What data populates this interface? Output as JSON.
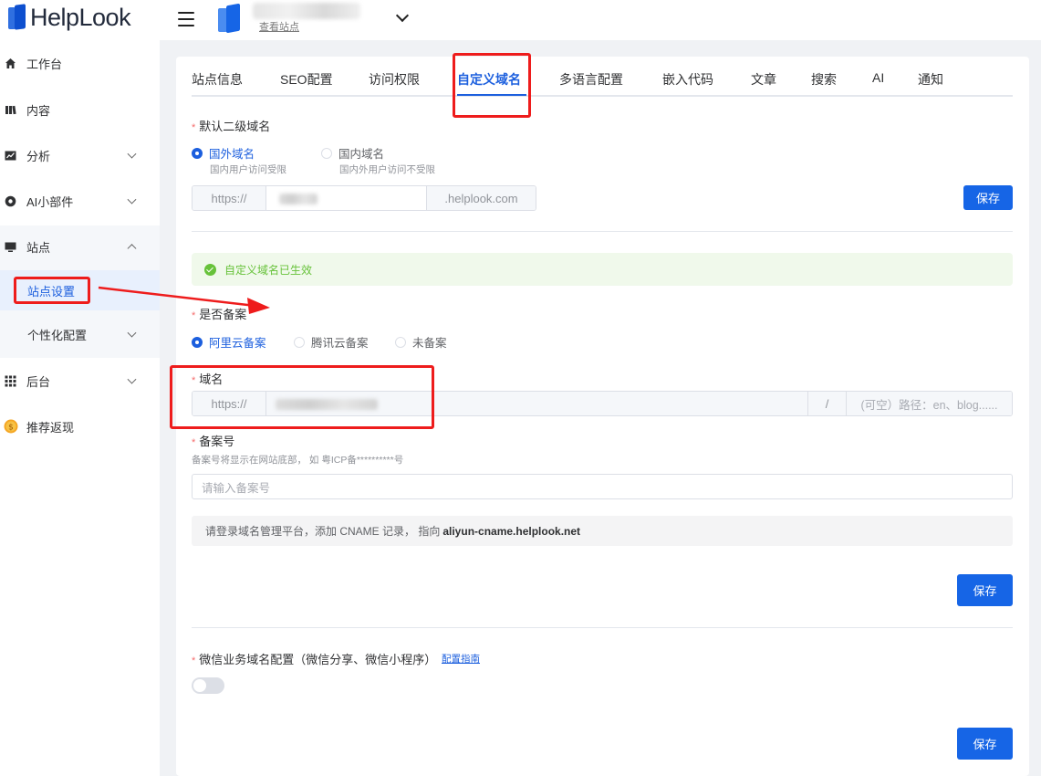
{
  "brand": {
    "name": "HelpLook"
  },
  "sidebar": {
    "items": [
      {
        "label": "工作台",
        "icon": "home-icon"
      },
      {
        "label": "内容",
        "icon": "book-icon"
      },
      {
        "label": "分析",
        "icon": "chart-icon"
      },
      {
        "label": "AI小部件",
        "icon": "ai-widget-icon"
      },
      {
        "label": "站点",
        "icon": "monitor-icon"
      },
      {
        "label": "后台",
        "icon": "grid-icon"
      },
      {
        "label": "推荐返现",
        "icon": "coin-icon"
      }
    ],
    "sub_items": [
      {
        "label": "站点设置"
      },
      {
        "label": "个性化配置"
      }
    ]
  },
  "topbar": {
    "view_site": "查看站点"
  },
  "tabs": [
    "站点信息",
    "SEO配置",
    "访问权限",
    "自定义域名",
    "多语言配置",
    "嵌入代码",
    "文章",
    "搜索",
    "AI",
    "通知"
  ],
  "active_tab": "自定义域名",
  "default_domain": {
    "label": "默认二级域名",
    "options": [
      {
        "label": "国外域名",
        "hint": "国内用户访问受限",
        "selected": true
      },
      {
        "label": "国内域名",
        "hint": "国内外用户访问不受限",
        "selected": false
      }
    ],
    "prefix": "https://",
    "suffix": ".helplook.com",
    "save": "保存"
  },
  "status_alert": "自定义域名已生效",
  "icp_filing": {
    "label": "是否备案",
    "options": [
      {
        "label": "阿里云备案",
        "selected": true
      },
      {
        "label": "腾讯云备案",
        "selected": false
      },
      {
        "label": "未备案",
        "selected": false
      }
    ]
  },
  "domain": {
    "label": "域名",
    "prefix": "https://",
    "separator": "/",
    "path_placeholder": "(可空）路径：en、blog......"
  },
  "filing_number": {
    "label": "备案号",
    "hint": "备案号将显示在网站底部， 如 粤ICP备**********号",
    "placeholder": "请输入备案号"
  },
  "cname_notice": {
    "text": "请登录域名管理平台，添加 CNAME 记录， 指向",
    "target": "aliyun-cname.helplook.net"
  },
  "save_main": "保存",
  "wechat": {
    "label": "微信业务域名配置（微信分享、微信小程序）",
    "link": "配置指南",
    "enabled": false,
    "save": "保存"
  }
}
